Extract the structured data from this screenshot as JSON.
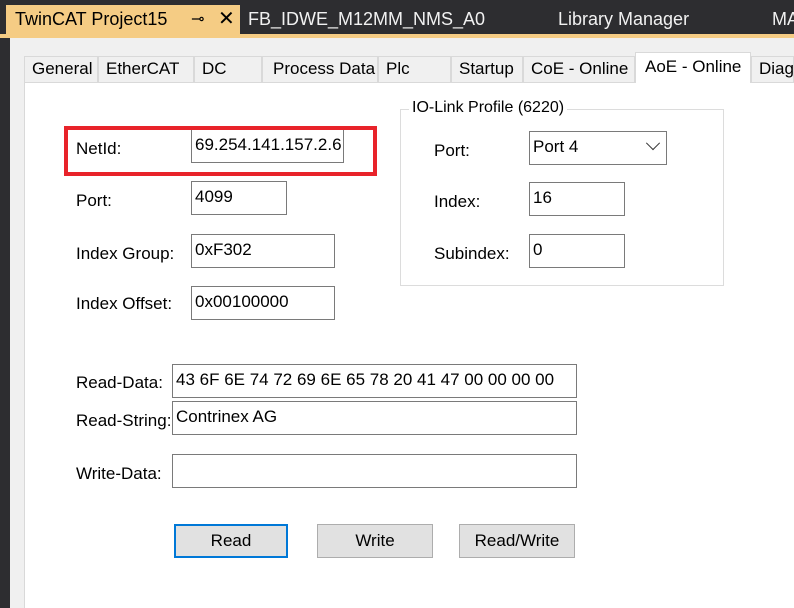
{
  "doc_tabs": [
    {
      "label": "TwinCAT Project15",
      "active": true
    },
    {
      "label": "FB_IDWE_M12MM_NMS_A0",
      "active": false
    },
    {
      "label": "Library Manager",
      "active": false
    },
    {
      "label": "MA",
      "active": false
    }
  ],
  "icons": {
    "pin": "pin-icon",
    "close": "close-icon"
  },
  "prop_tabs": [
    {
      "label": "General"
    },
    {
      "label": "EtherCAT"
    },
    {
      "label": "DC"
    },
    {
      "label": "Process Data"
    },
    {
      "label": "Plc"
    },
    {
      "label": "Startup"
    },
    {
      "label": "CoE - Online"
    },
    {
      "label": "AoE - Online",
      "active": true
    },
    {
      "label": "Diag"
    }
  ],
  "form": {
    "netid_label": "NetId:",
    "netid_value": "69.254.141.157.2.6",
    "port_label": "Port:",
    "port_value": "4099",
    "index_group_label": "Index Group:",
    "index_group_value": "0xF302",
    "index_offset_label": "Index Offset:",
    "index_offset_value": "0x00100000",
    "read_data_label": "Read-Data:",
    "read_data_value": "43 6F 6E 74 72 69 6E 65 78 20 41 47 00 00 00 00",
    "read_string_label": "Read-String:",
    "read_string_value": "Contrinex AG",
    "write_data_label": "Write-Data:",
    "write_data_value": ""
  },
  "iolink": {
    "title": "IO-Link Profile (6220)",
    "port_label": "Port:",
    "port_value": "Port 4",
    "index_label": "Index:",
    "index_value": "16",
    "subindex_label": "Subindex:",
    "subindex_value": "0"
  },
  "buttons": {
    "read": "Read",
    "write": "Write",
    "readwrite": "Read/Write"
  },
  "colors": {
    "active_tab": "#f5cc84",
    "highlight": "#e8232a",
    "default_button_border": "#0078d7"
  }
}
